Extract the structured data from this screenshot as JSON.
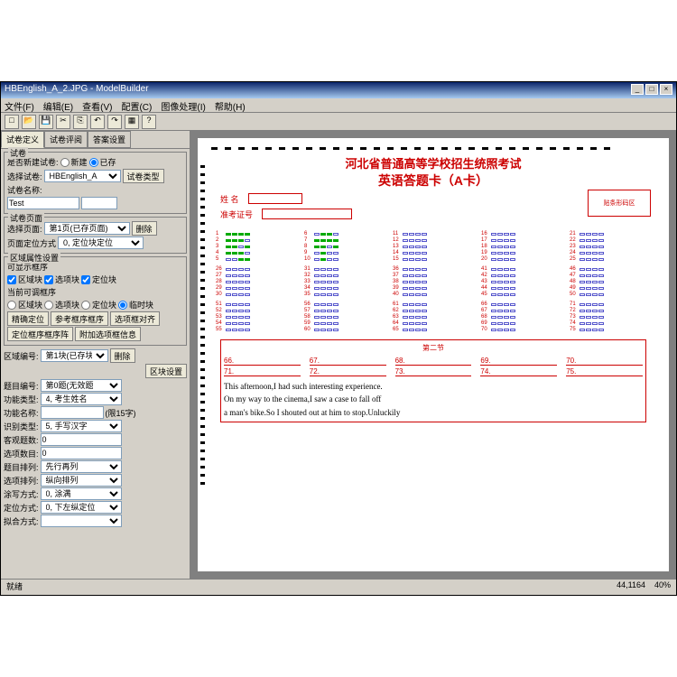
{
  "title": "HBEnglish_A_2.JPG - ModelBuilder",
  "menus": [
    "文件(F)",
    "编辑(E)",
    "查看(V)",
    "配置(C)",
    "图像处理(I)",
    "帮助(H)"
  ],
  "tabs": [
    "试卷定义",
    "试卷评阅",
    "答案设置"
  ],
  "panel": {
    "g1_title": "试卷",
    "new_or_saved": "是否新建试卷:",
    "radio_new": "新建",
    "radio_saved": "已存",
    "select_exam": "选择试卷:",
    "exam_value": "HBEnglish_A",
    "exam_name": "试卷名称:",
    "exam_name_val": "Test",
    "btn_type": "试卷类型",
    "g2_title": "试卷页面",
    "select_page": "选择页面:",
    "page_value": "第1页(已存页面)",
    "btn_del": "删除",
    "page_locate": "页面定位方式",
    "locate_val": "0, 定位块定位",
    "g3_title": "区域属性设置",
    "show_frame": "可显示框序",
    "cb1": "区域块",
    "cb2": "选项块",
    "cb3": "定位块",
    "adjust_frame": "当前可调框序",
    "rb1": "区域块",
    "rb2": "选项块",
    "rb3": "定位块",
    "rb4": "临时块",
    "btn_a": "精确定位",
    "btn_b": "参考框序框序",
    "btn_c": "选项框对齐",
    "btn_d": "定位框序框序阵",
    "btn_e": "附加选项框信息",
    "block_num": "区域编号:",
    "block_val": "第1块(已存块",
    "btn_del2": "删除",
    "btn_cfg": "区块设置",
    "q_num": "题目编号:",
    "q_val": "第0题(无效题",
    "func_type": "功能类型:",
    "func_val": "4, 考生姓名",
    "func_name": "功能名称:",
    "func_limit": "(限15字)",
    "rec_type": "识别类型:",
    "rec_val": "5, 手写汉字",
    "obj_q": "客观题数:",
    "obj_val": "0",
    "opt_n": "选项数目:",
    "opt_val": "0",
    "q_arr": "题目排列:",
    "q_arr_val": "先行再列",
    "opt_arr": "选项排列:",
    "opt_arr_val": "纵向排列",
    "smear": "涂写方式:",
    "smear_val": "0, 涂满",
    "loc_mode": "定位方式:",
    "loc_val": "0, 下左纵定位",
    "fit_mode": "拟合方式:"
  },
  "sheet": {
    "title1": "河北省普通高等学校招生统照考试",
    "title2": "英语答题卡（A卡）",
    "name": "姓 名",
    "exam_no": "准考证号",
    "barcode": "贴条形码区",
    "section2": "第二节",
    "essay": "This afternoon,I had such interesting experience.\nOn my way to the cinema,I saw a case to fall off\na man's bike.So I shouted out at him to stop.Unluckily",
    "nums": [
      "66.",
      "67.",
      "68.",
      "69.",
      "70.",
      "71.",
      "72.",
      "73.",
      "74.",
      "75."
    ]
  },
  "status": {
    "ready": "就绪",
    "coords": "44,1164",
    "zoom": "40%"
  },
  "winbtns": [
    "_",
    "□",
    "×"
  ]
}
